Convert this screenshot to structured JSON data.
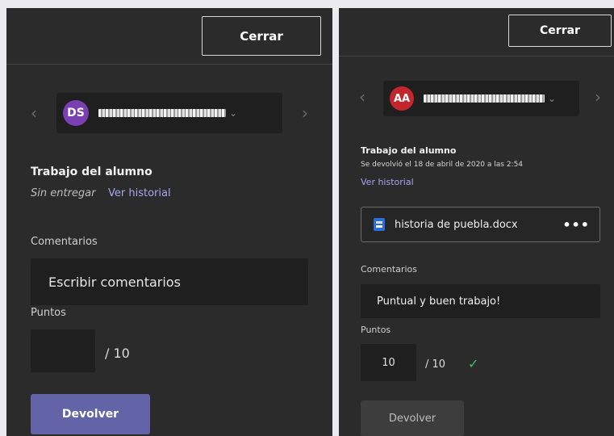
{
  "colors": {
    "panel_bg": "#2b2b2b",
    "accent_purple": "#6264a7",
    "link": "#a6a6f2",
    "success_green": "#3cc15a",
    "avatar_ds": "#7a3fb0",
    "avatar_aa": "#c4262e"
  },
  "left_panel": {
    "close_label": "Cerrar",
    "prev_icon": "chevron-left",
    "next_icon": "chevron-right",
    "student": {
      "initials": "DS",
      "dropdown_icon": "chevron-down"
    },
    "work_title": "Trabajo del alumno",
    "status": "Sin entregar",
    "history_link": "Ver historial",
    "comments_label": "Comentarios",
    "comments_placeholder": "Escribir comentarios",
    "points_label": "Puntos",
    "points_value": "",
    "points_total": "/ 10",
    "return_label": "Devolver"
  },
  "right_panel": {
    "close_label": "Cerrar",
    "prev_icon": "chevron-left",
    "next_icon": "chevron-right",
    "student": {
      "initials": "AA",
      "dropdown_icon": "chevron-down"
    },
    "work_title": "Trabajo del alumno",
    "returned_text": "Se devolvió el 18 de abril de 2020 a las 2:54",
    "history_link": "Ver historial",
    "file": {
      "name": "historia de puebla.docx",
      "icon": "word-doc",
      "more_icon": "ellipsis"
    },
    "comments_label": "Comentarios",
    "comments_value": "Puntual y buen trabajo!",
    "points_label": "Puntos",
    "points_value": "10",
    "points_total": "/ 10",
    "check_icon": "checkmark",
    "return_label": "Devolver"
  }
}
